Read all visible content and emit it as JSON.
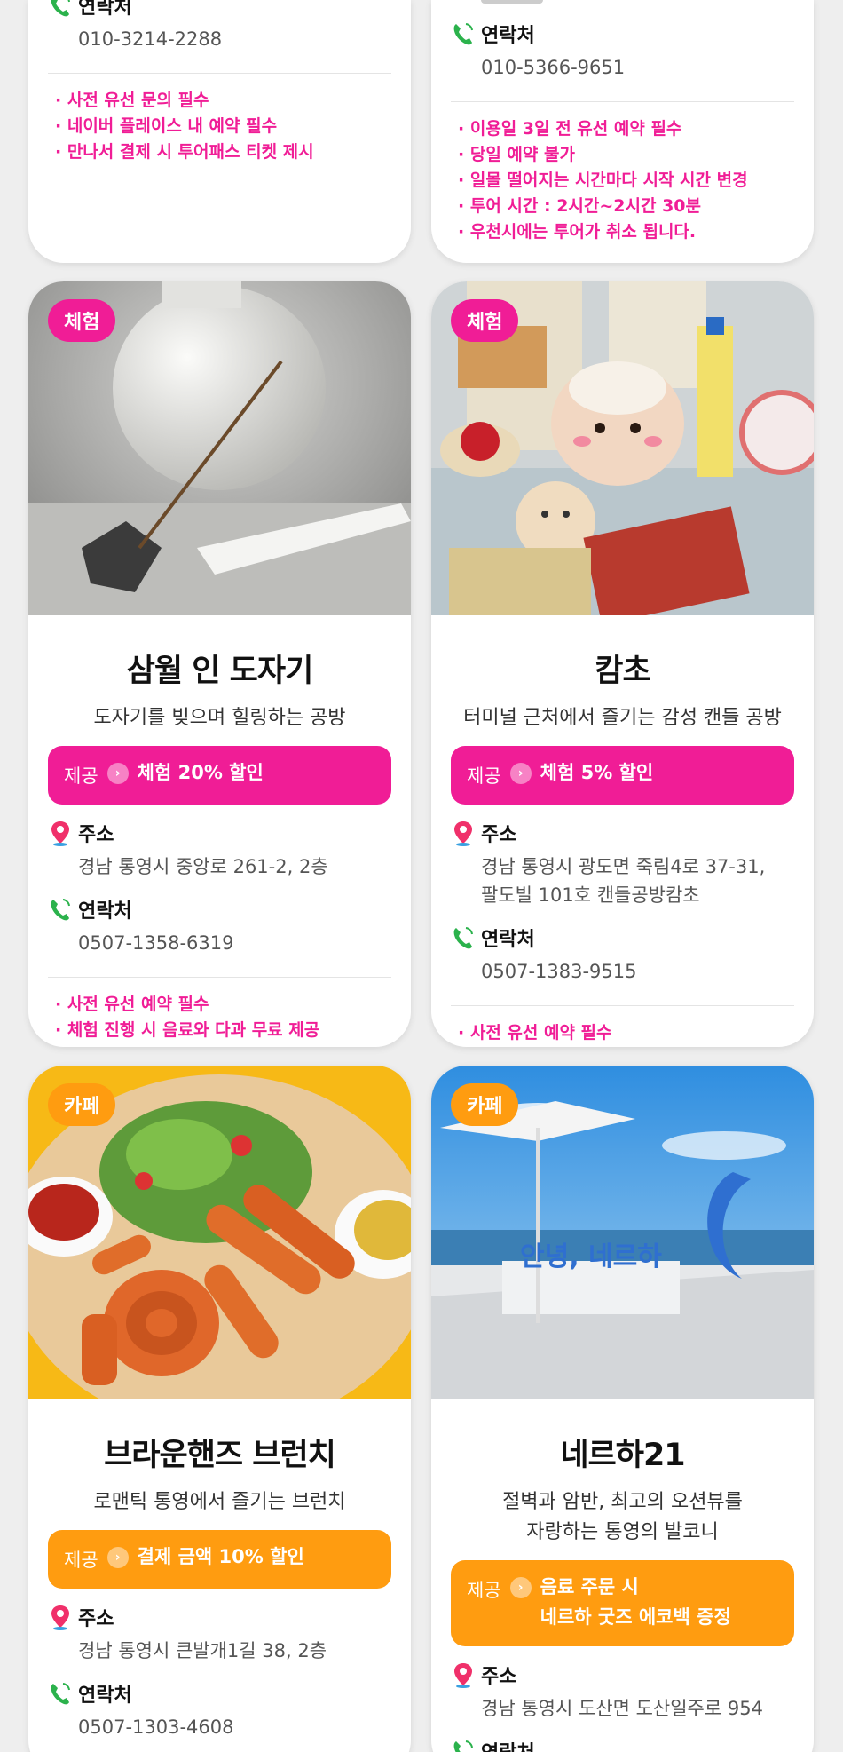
{
  "top_left": {
    "contact_label": "연락처",
    "phone": "010-3214-2288",
    "notes": [
      "· 사전 유선 문의 필수",
      "· 네이버 플레이스 내 예약 필수",
      "· 만나서 결제 시 투어패스 티켓 제시"
    ]
  },
  "top_right": {
    "contact_label": "연락처",
    "phone": "010-5366-9651",
    "notes": [
      "· 이용일 3일 전 유선 예약 필수",
      "· 당일 예약 불가",
      "· 일몰 떨어지는 시간마다 시작 시간 변경",
      "· 투어 시간 : 2시간~2시간 30분",
      "· 우천시에는 투어가 취소 됩니다."
    ]
  },
  "cards": [
    {
      "tag": "체험",
      "title": "삼월 인 도자기",
      "subtitle": "도자기를 빚으며 힐링하는 공방",
      "offer_label": "제공",
      "offer_text": "체험 20% 할인",
      "address_label": "주소",
      "address": "경남 통영시 중앙로 261-2, 2층",
      "contact_label": "연락처",
      "phone": "0507-1358-6319",
      "notes": [
        "· 사전 유선 예약 필수",
        "· 체험 진행 시 음료와 다과 무료 제공"
      ]
    },
    {
      "tag": "체험",
      "title": "캄초",
      "subtitle": "터미널 근처에서 즐기는 감성 캔들 공방",
      "offer_label": "제공",
      "offer_text": "체험 5% 할인",
      "address_label": "주소",
      "address": "경남 통영시 광도면 죽림4로 37-31,",
      "address2": "팔도빌 101호 캔들공방캄초",
      "contact_label": "연락처",
      "phone": "0507-1383-9515",
      "notes": [
        "· 사전 유선 예약 필수"
      ]
    },
    {
      "tag": "카페",
      "title": "브라운핸즈 브런치",
      "subtitle": "로맨틱 통영에서 즐기는 브런치",
      "offer_label": "제공",
      "offer_text": "결제 금액 10% 할인",
      "address_label": "주소",
      "address": "경남 통영시 큰발개1길 38, 2층",
      "contact_label": "연락처",
      "phone": "0507-1303-4608"
    },
    {
      "tag": "카페",
      "title": "네르하21",
      "subtitle": "절벽과 암반, 최고의 오션뷰를",
      "subtitle2": "자랑하는 통영의 발코니",
      "offer_label": "제공",
      "offer_text": "음료 주문 시",
      "offer_text2": "네르하 굿즈 에코백 증정",
      "address_label": "주소",
      "address": "경남 통영시 도산면 도산일주로 954",
      "contact_label": "연락처",
      "photo_sign": "안녕, 네르하"
    }
  ],
  "colors": {
    "pink": "#f01d96",
    "orange": "#ff9c10",
    "pin": "#f0306a",
    "phone_icon": "#2bb24c"
  },
  "icons": {
    "address": "location-pin-icon",
    "contact": "phone-icon",
    "offer": "chevron-right-icon"
  }
}
